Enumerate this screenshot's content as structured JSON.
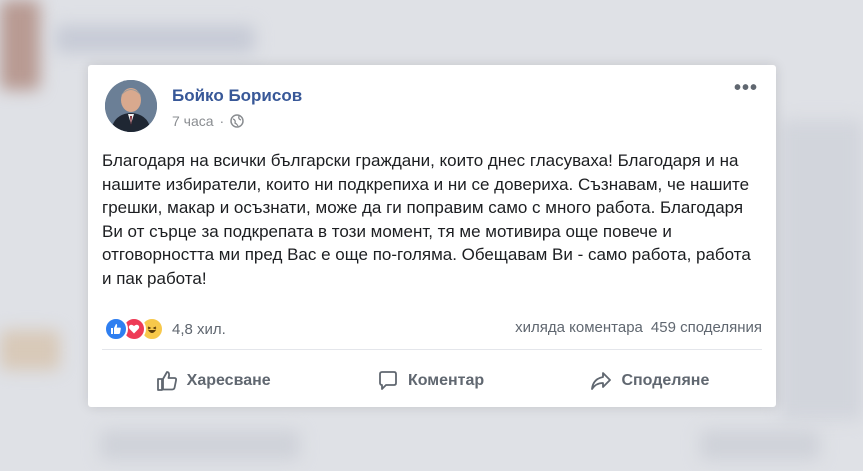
{
  "post": {
    "author": "Бойко Борисов",
    "time": "7 часа",
    "time_separator": "·",
    "more_label": "•••",
    "text": "Благодаря на всички български граждани, които днес гласуваха! Благодаря и на нашите избиратели, които ни подкрепиха и ни се довериха. Съзнавам, че нашите грешки, макар и осъзнати, може да ги поправим само с много работа. Благодаря Ви от сърце за подкрепата в този момент, тя ме мотивира още повече и отговорността ми пред Вас е още по-голяма. Обещавам Ви - само работа, работа и пак работа!",
    "reactions_count": "4,8 хил.",
    "comments": "хиляда коментара",
    "shares": "459 споделяния"
  },
  "actions": {
    "like": "Харесване",
    "comment": "Коментар",
    "share": "Споделяне"
  },
  "icons": {
    "privacy": "globe-icon",
    "like_reaction": "like-reaction-icon",
    "love_reaction": "love-reaction-icon",
    "haha_reaction": "haha-reaction-icon"
  }
}
